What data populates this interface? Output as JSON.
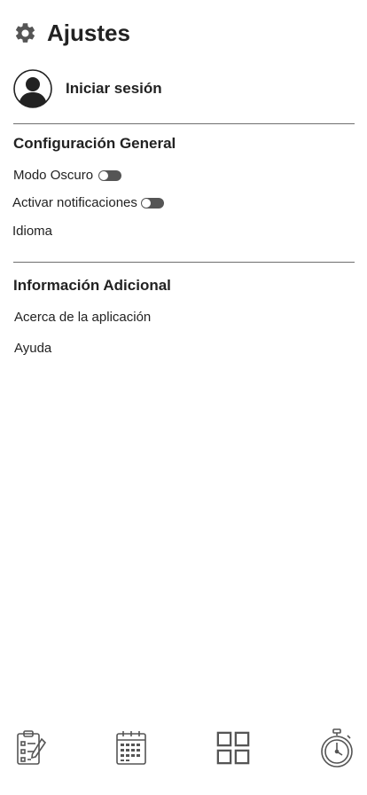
{
  "header": {
    "title": "Ajustes",
    "icon": "gear-icon"
  },
  "account": {
    "login_label": "Iniciar sesión",
    "icon": "user-avatar-icon"
  },
  "general": {
    "title": "Configuración General",
    "dark_mode_label": "Modo Oscuro",
    "dark_mode_enabled": false,
    "notifications_label": "Activar notificaciones",
    "notifications_enabled": false,
    "language_label": "Idioma"
  },
  "additional": {
    "title": "Información Adicional",
    "about_label": "Acerca de la aplicación",
    "help_label": "Ayuda"
  },
  "bottom_nav": {
    "items": [
      {
        "icon": "clipboard-edit-icon"
      },
      {
        "icon": "calendar-icon"
      },
      {
        "icon": "grid-icon"
      },
      {
        "icon": "stopwatch-icon"
      }
    ]
  },
  "colors": {
    "icon": "#555555",
    "text": "#222222",
    "divider": "#6f6f6f",
    "toggle": "#555555"
  }
}
